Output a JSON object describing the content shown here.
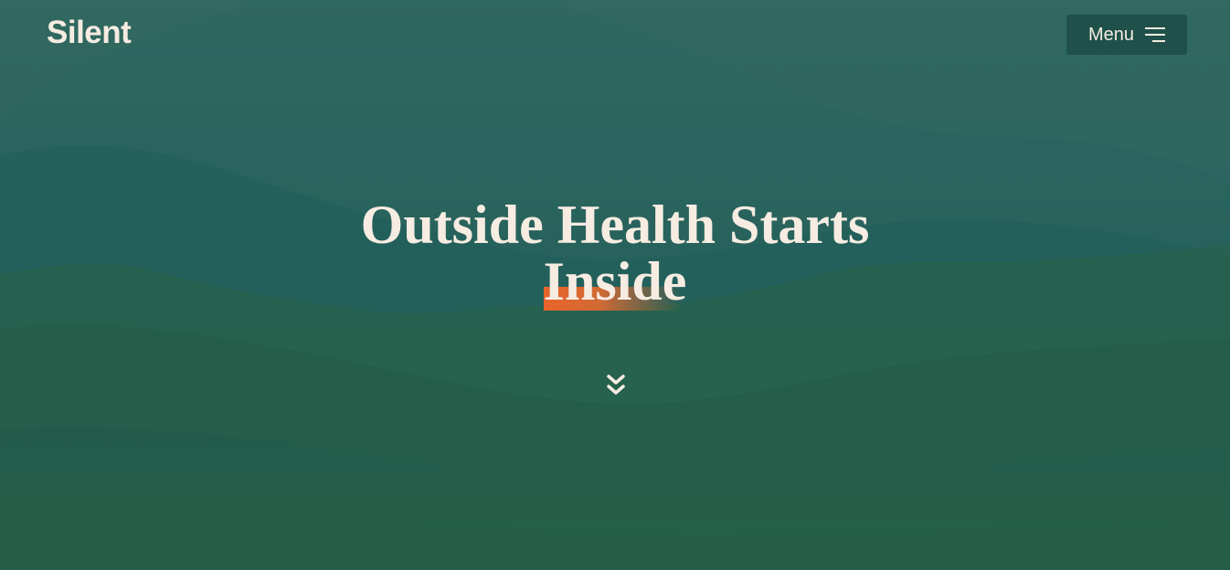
{
  "header": {
    "brand": "Silent",
    "menu_label": "Menu",
    "menu_icon": "hamburger-menu-icon"
  },
  "hero": {
    "headline_line1": "Outside Health Starts",
    "headline_line2": "Inside",
    "scroll_icon": "double-chevron-down-icon"
  },
  "colors": {
    "text": "#f6ece2",
    "accent": "#e8642a",
    "overlay": "#185854",
    "menu_bg": "#1c4e46"
  }
}
